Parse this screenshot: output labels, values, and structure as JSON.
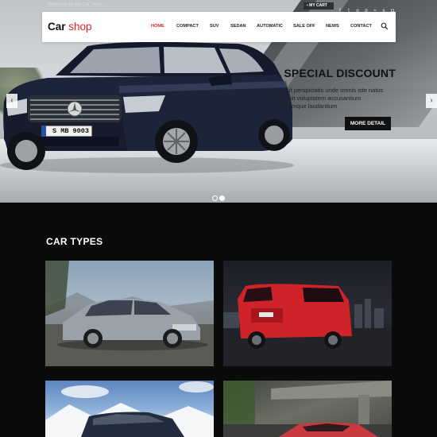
{
  "topbar": {
    "welcome": "Welcome to the Car Shop",
    "cart_label": "MY CART",
    "social_icons": [
      "facebook-icon",
      "twitter-icon",
      "google-plus-icon",
      "pinterest-icon",
      "rss-icon",
      "skype-icon",
      "instagram-icon"
    ]
  },
  "header": {
    "logo_main": "Car ",
    "logo_accent": "shop",
    "nav": [
      "HOME",
      "COMPACT",
      "SUV",
      "SEDAN",
      "AUTOMATIC",
      "SALE OFF",
      "NEWS",
      "CONTACT"
    ],
    "active_nav": "HOME",
    "plate": "S MB 9003"
  },
  "slider": {
    "title": "SPECIAL DISCOUNT",
    "description": "Sed ut perspiciatis unde omnis iste natus error sit voluptatem accusantium doloremque laudantium",
    "button": "MORE DETAIL",
    "prev_arrow": "‹",
    "next_arrow": "›",
    "slide_count": 2,
    "active_slide": 2
  },
  "car_types": {
    "title": "CAR TYPES"
  },
  "colors": {
    "accent": "#d9262c",
    "dark": "#0b0b0b"
  }
}
